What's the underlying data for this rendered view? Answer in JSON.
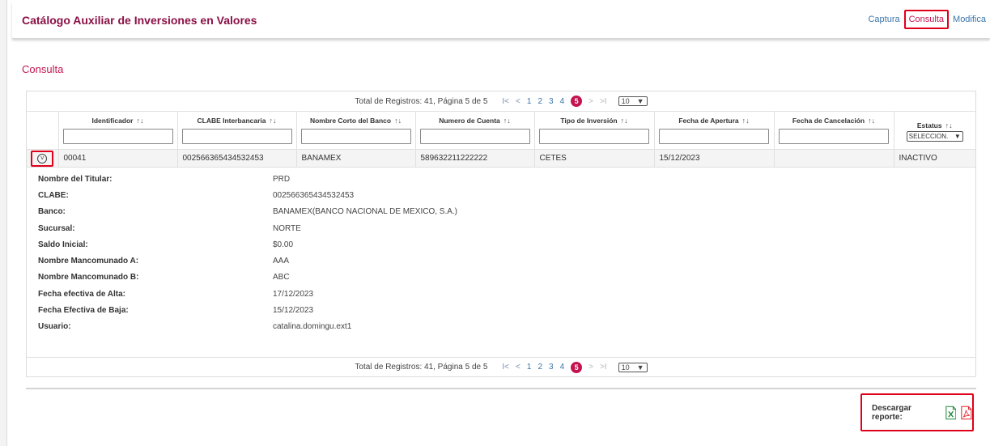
{
  "header": {
    "title": "Catálogo Auxiliar de Inversiones en Valores",
    "nav": [
      "Captura",
      "Consulta",
      "Modifica"
    ]
  },
  "section": {
    "title": "Consulta"
  },
  "pager": {
    "info": "Total de Registros: 41, Página 5 de 5",
    "first": "I<",
    "prev": "<",
    "pages": [
      "1",
      "2",
      "3",
      "4"
    ],
    "current": "5",
    "next": ">",
    "last": ">I",
    "page_size": "10"
  },
  "table": {
    "columns": [
      "Identificador",
      "CLABE Interbancaria",
      "Nombre Corto del Banco",
      "Numero de Cuenta",
      "Tipo de Inversión",
      "Fecha de Apertura",
      "Fecha de Cancelación",
      "Estatus"
    ],
    "status_filter": "SELECCION.",
    "row": {
      "identificador": "00041",
      "clabe": "002566365434532453",
      "banco": "BANAMEX",
      "cuenta": "589632211222222",
      "tipo": "CETES",
      "apertura": "15/12/2023",
      "cancelacion": "",
      "estatus": "INACTIVO"
    }
  },
  "details": [
    {
      "label": "Nombre del Titular:",
      "value": "PRD"
    },
    {
      "label": "CLABE:",
      "value": "002566365434532453"
    },
    {
      "label": "Banco:",
      "value": "BANAMEX(BANCO NACIONAL DE MEXICO, S.A.)"
    },
    {
      "label": "Sucursal:",
      "value": "NORTE"
    },
    {
      "label": "Saldo Inicial:",
      "value": "$0.00"
    },
    {
      "label": "Nombre Mancomunado A:",
      "value": "AAA"
    },
    {
      "label": "Nombre Mancomunado B:",
      "value": "ABC"
    },
    {
      "label": "Fecha efectiva de Alta:",
      "value": "17/12/2023"
    },
    {
      "label": "Fecha Efectiva de Baja:",
      "value": "15/12/2023"
    },
    {
      "label": "Usuario:",
      "value": "catalina.domingu.ext1"
    }
  ],
  "download": {
    "label": "Descargar reporte:",
    "excel_icon": "excel-file-icon",
    "pdf_icon": "pdf-file-icon"
  },
  "colors": {
    "brand": "#8a1046",
    "accent": "#c4134f",
    "highlight": "#e0001b",
    "link": "#3b74a8"
  }
}
